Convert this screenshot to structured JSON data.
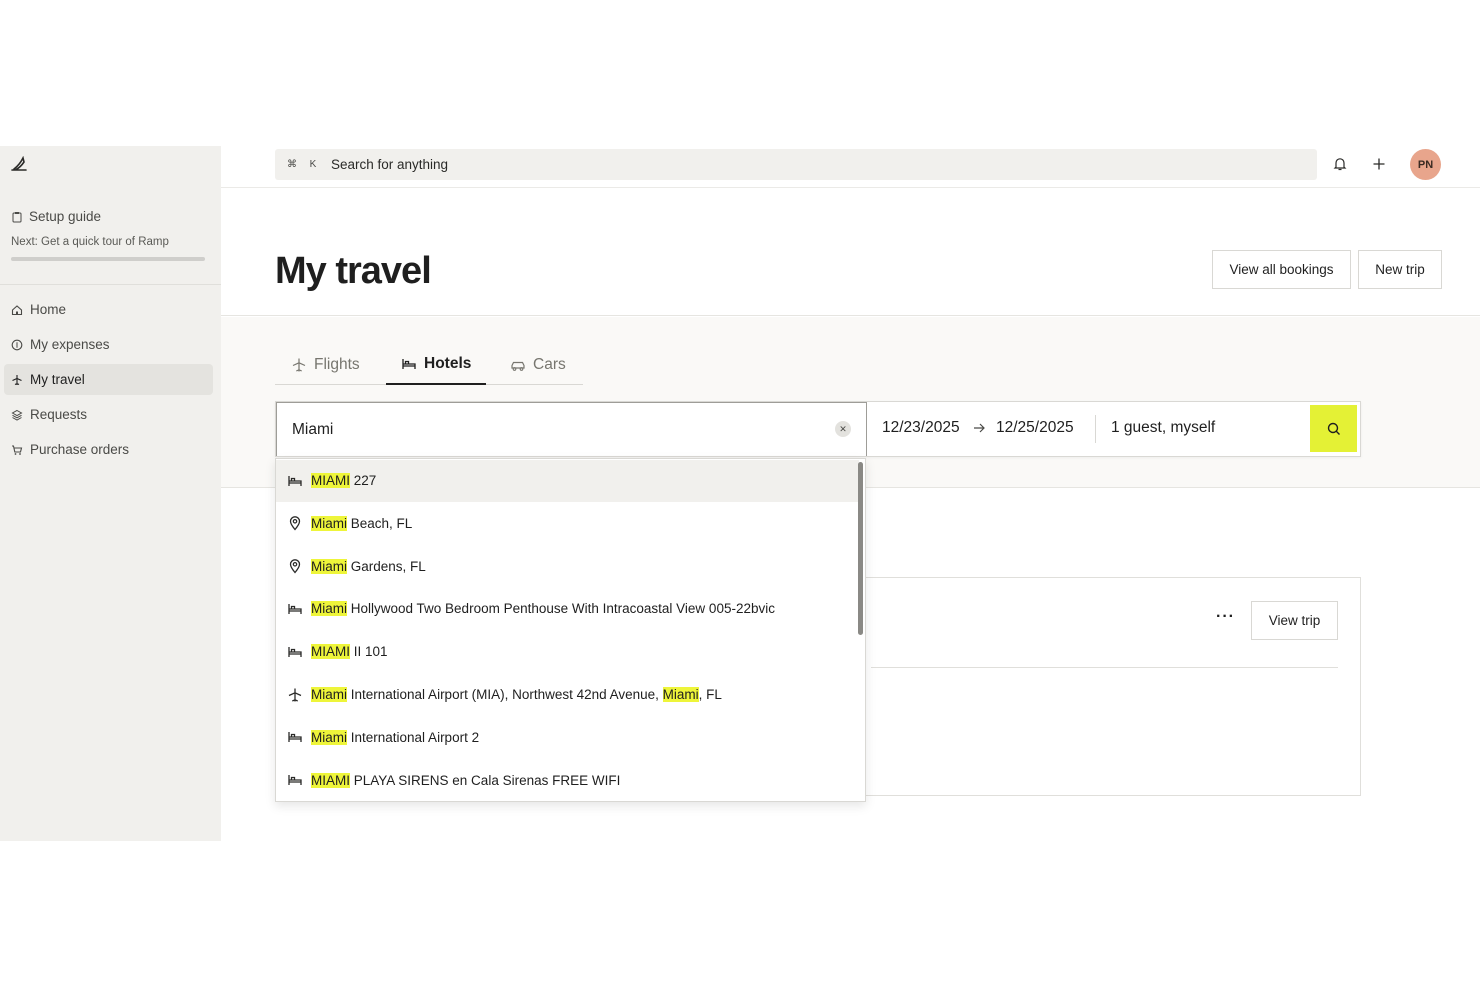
{
  "sidebar": {
    "setup_label": "Setup guide",
    "setup_next": "Next: Get a quick tour of Ramp",
    "setup_progress": 1.0,
    "items": [
      {
        "label": "Home",
        "icon": "home-icon",
        "active": false
      },
      {
        "label": "My expenses",
        "icon": "dollar-circle-icon",
        "active": false
      },
      {
        "label": "My travel",
        "icon": "plane-icon",
        "active": true
      },
      {
        "label": "Requests",
        "icon": "layers-icon",
        "active": false
      },
      {
        "label": "Purchase orders",
        "icon": "cart-icon",
        "active": false
      }
    ]
  },
  "topbar": {
    "kbd_cmd": "⌘",
    "kbd_k": "K",
    "search_placeholder": "Search for anything",
    "avatar_initials": "PN"
  },
  "header": {
    "title": "My travel",
    "view_all_label": "View all bookings",
    "new_trip_label": "New trip"
  },
  "tabs": [
    {
      "label": "Flights",
      "icon": "plane-icon",
      "active": false
    },
    {
      "label": "Hotels",
      "icon": "bed-icon",
      "active": true
    },
    {
      "label": "Cars",
      "icon": "car-icon",
      "active": false
    }
  ],
  "search": {
    "location_value": "Miami",
    "check_in": "12/23/2025",
    "check_out": "12/25/2025",
    "guests": "1 guest, myself",
    "accent": "#e4f135"
  },
  "card": {
    "more_label": "···",
    "view_trip_label": "View trip"
  },
  "dropdown": [
    {
      "icon": "bed-icon",
      "parts": [
        {
          "t": "MIAMI",
          "hl": true
        },
        {
          "t": " 227",
          "hl": false
        }
      ]
    },
    {
      "icon": "map-pin-icon",
      "parts": [
        {
          "t": "Miami",
          "hl": true
        },
        {
          "t": " Beach, FL",
          "hl": false
        }
      ]
    },
    {
      "icon": "map-pin-icon",
      "parts": [
        {
          "t": "Miami",
          "hl": true
        },
        {
          "t": " Gardens, FL",
          "hl": false
        }
      ]
    },
    {
      "icon": "bed-icon",
      "parts": [
        {
          "t": "Miami",
          "hl": true
        },
        {
          "t": " Hollywood Two Bedroom Penthouse With Intracoastal View 005-22bvic",
          "hl": false
        }
      ]
    },
    {
      "icon": "bed-icon",
      "parts": [
        {
          "t": "MIAMI",
          "hl": true
        },
        {
          "t": " II 101",
          "hl": false
        }
      ]
    },
    {
      "icon": "plane-icon",
      "parts": [
        {
          "t": "Miami",
          "hl": true
        },
        {
          "t": " International Airport (MIA), Northwest 42nd Avenue, ",
          "hl": false
        },
        {
          "t": "Miami",
          "hl": true
        },
        {
          "t": ", FL",
          "hl": false
        }
      ]
    },
    {
      "icon": "bed-icon",
      "parts": [
        {
          "t": "Miami",
          "hl": true
        },
        {
          "t": " International Airport 2",
          "hl": false
        }
      ]
    },
    {
      "icon": "bed-icon",
      "parts": [
        {
          "t": "MIAMI",
          "hl": true
        },
        {
          "t": " PLAYA SIRENS en Cala Sirenas FREE WIFI",
          "hl": false
        }
      ]
    }
  ]
}
